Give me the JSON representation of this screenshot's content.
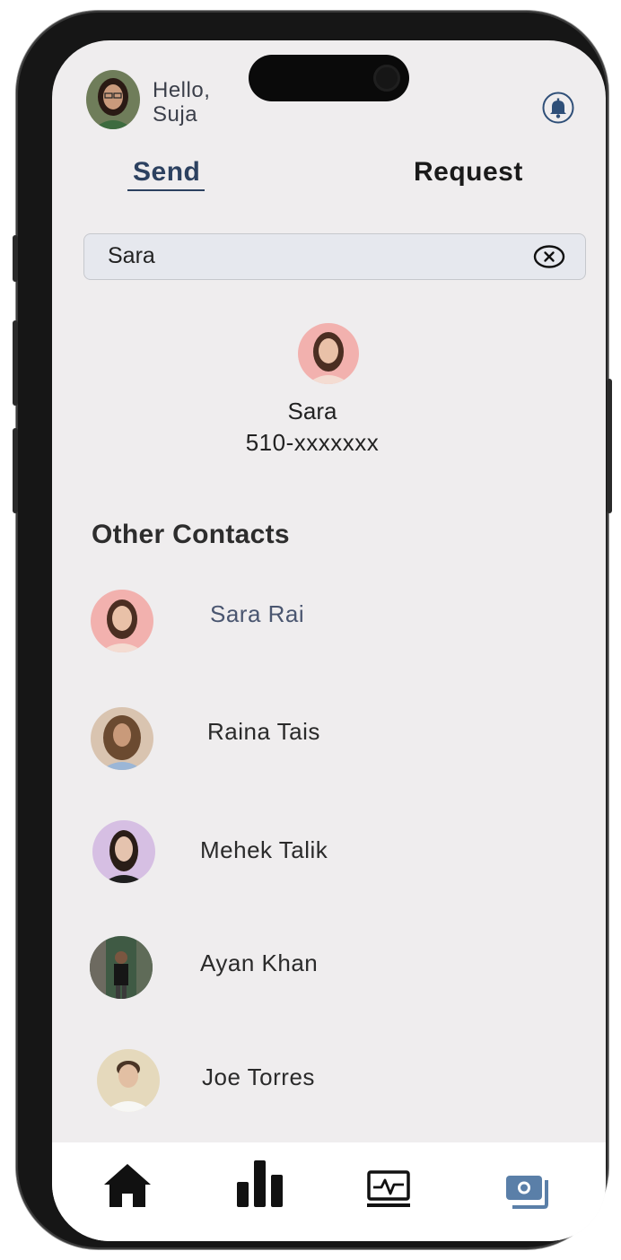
{
  "header": {
    "greeting_line1": "Hello,",
    "greeting_line2": "Suja",
    "notification_icon": "bell-icon"
  },
  "tabs": {
    "send_label": "Send",
    "request_label": "Request",
    "active": "Send"
  },
  "search": {
    "value": "Sara",
    "clear_icon": "close-circle-icon"
  },
  "search_result": {
    "name": "Sara",
    "phone": "510-xxxxxxx"
  },
  "other_contacts": {
    "title": "Other Contacts",
    "items": [
      {
        "name": "Sara Rai"
      },
      {
        "name": "Raina Tais"
      },
      {
        "name": "Mehek Talik"
      },
      {
        "name": "Ayan Khan"
      },
      {
        "name": "Joe Torres"
      }
    ]
  },
  "bottom_nav": {
    "items": [
      {
        "icon": "home-icon"
      },
      {
        "icon": "bar-chart-icon"
      },
      {
        "icon": "activity-monitor-icon"
      },
      {
        "icon": "wallet-cash-icon"
      }
    ],
    "active": "wallet-cash-icon"
  },
  "colors": {
    "accent": "#2c4160",
    "screen_bg": "#efedee",
    "search_bg": "#e6e8ee",
    "active_nav": "#5a7fa8"
  }
}
